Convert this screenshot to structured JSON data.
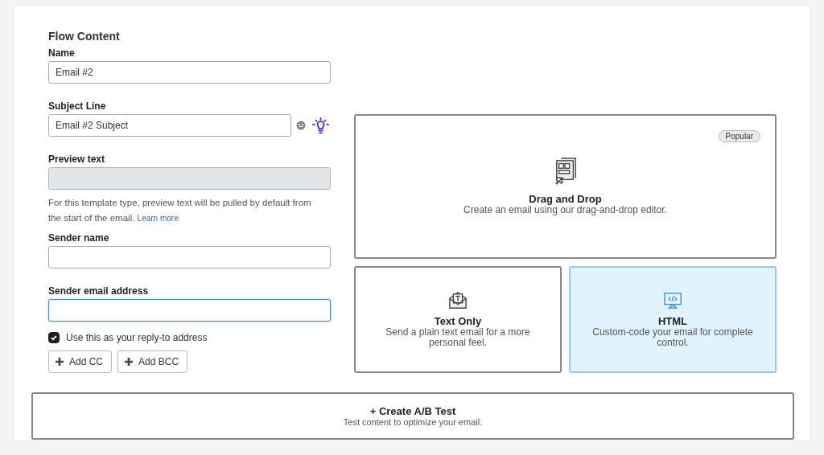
{
  "section_title": "Flow Content",
  "fields": [
    {
      "label": "Name",
      "value": "Email #2",
      "disabled": false,
      "focused": false,
      "extras": false
    },
    {
      "label": "Subject Line",
      "value": "Email #2 Subject",
      "disabled": false,
      "focused": false,
      "extras": true
    },
    {
      "label": "Preview text",
      "disabled": true,
      "focused": false,
      "extras": false,
      "help": "For this template type, preview text will be pulled by default from the start of the email.",
      "help_link": "Learn more"
    },
    {
      "label": "Sender name",
      "disabled": false,
      "focused": false,
      "extras": false
    },
    {
      "label": "Sender email address",
      "disabled": false,
      "focused": true,
      "extras": false
    }
  ],
  "reply_to": {
    "label": "Use this as your reply-to address",
    "checked": true
  },
  "add_buttons": [
    "Add CC",
    "Add BCC"
  ],
  "templates": [
    {
      "kind": "dragdrop",
      "title": "Drag and Drop",
      "description": "Create an email using our drag-and-drop editor.",
      "badge": "Popular",
      "selected": false
    },
    {
      "kind": "text",
      "title": "Text Only",
      "description": "Send a plain text email for a more personal feel.",
      "selected": false
    },
    {
      "kind": "html",
      "title": "HTML",
      "description": "Custom-code your email for complete control.",
      "selected": true
    }
  ],
  "ab_test": {
    "title": "+ Create A/B Test",
    "description": "Test content to optimize your email."
  }
}
